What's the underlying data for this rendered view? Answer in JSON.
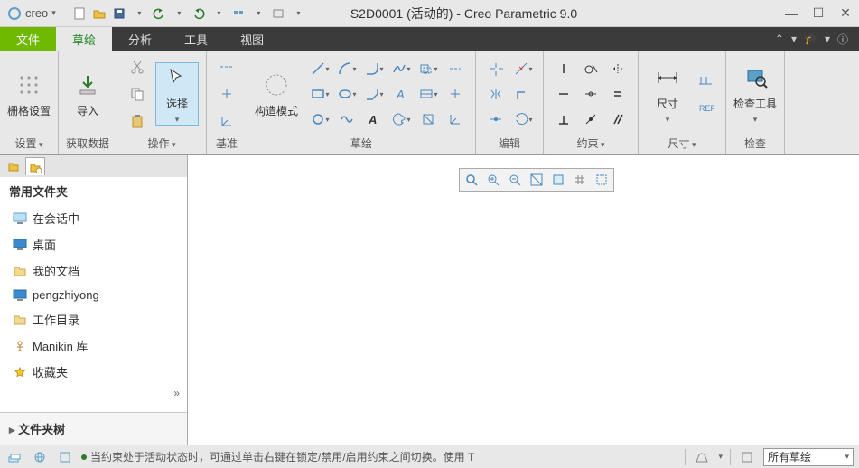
{
  "app": {
    "name": "creo",
    "title": "S2D0001 (活动的) - Creo Parametric 9.0"
  },
  "qat_icons": [
    "new-icon",
    "open-icon",
    "save-icon",
    "save-dd-icon",
    "undo-icon",
    "redo-icon",
    "regen-icon",
    "window-icon",
    "close-win-icon"
  ],
  "tabs": {
    "file": "文件",
    "items": [
      "草绘",
      "分析",
      "工具",
      "视图"
    ],
    "active": "草绘"
  },
  "ribbon": {
    "grid": {
      "btn": "栅格设置",
      "label": "设置"
    },
    "import": {
      "btn": "导入",
      "label": "获取数据"
    },
    "operate": {
      "btn": "选择",
      "label": "操作"
    },
    "datum": {
      "btn": "构造模式",
      "label": "基准"
    },
    "sketch": {
      "label": "草绘"
    },
    "edit": {
      "label": "编辑"
    },
    "constraint": {
      "label": "约束"
    },
    "dim": {
      "btn": "尺寸",
      "label": "尺寸"
    },
    "inspect": {
      "btn": "检查工具",
      "label": "检查"
    }
  },
  "side": {
    "header": "常用文件夹",
    "items": [
      {
        "icon": "monitor-icon",
        "label": "在会话中"
      },
      {
        "icon": "desktop-icon",
        "label": "桌面"
      },
      {
        "icon": "mydocs-icon",
        "label": "我的文档"
      },
      {
        "icon": "computer-icon",
        "label": "pengzhiyong"
      },
      {
        "icon": "workdir-icon",
        "label": "工作目录"
      },
      {
        "icon": "manikin-icon",
        "label": "Manikin 库"
      },
      {
        "icon": "favorites-icon",
        "label": "收藏夹"
      }
    ],
    "tree": "文件夹树"
  },
  "floating_icons": [
    "zoom-fit-icon",
    "zoom-in-icon",
    "zoom-out-icon",
    "repaint-icon",
    "grid-toggle-icon",
    "snap-icon",
    "ref-icon"
  ],
  "status": {
    "msg": "当约束处于活动状态时，可通过单击右键在锁定/禁用/启用约束之间切换。使用 T",
    "filter": "所有草绘"
  }
}
